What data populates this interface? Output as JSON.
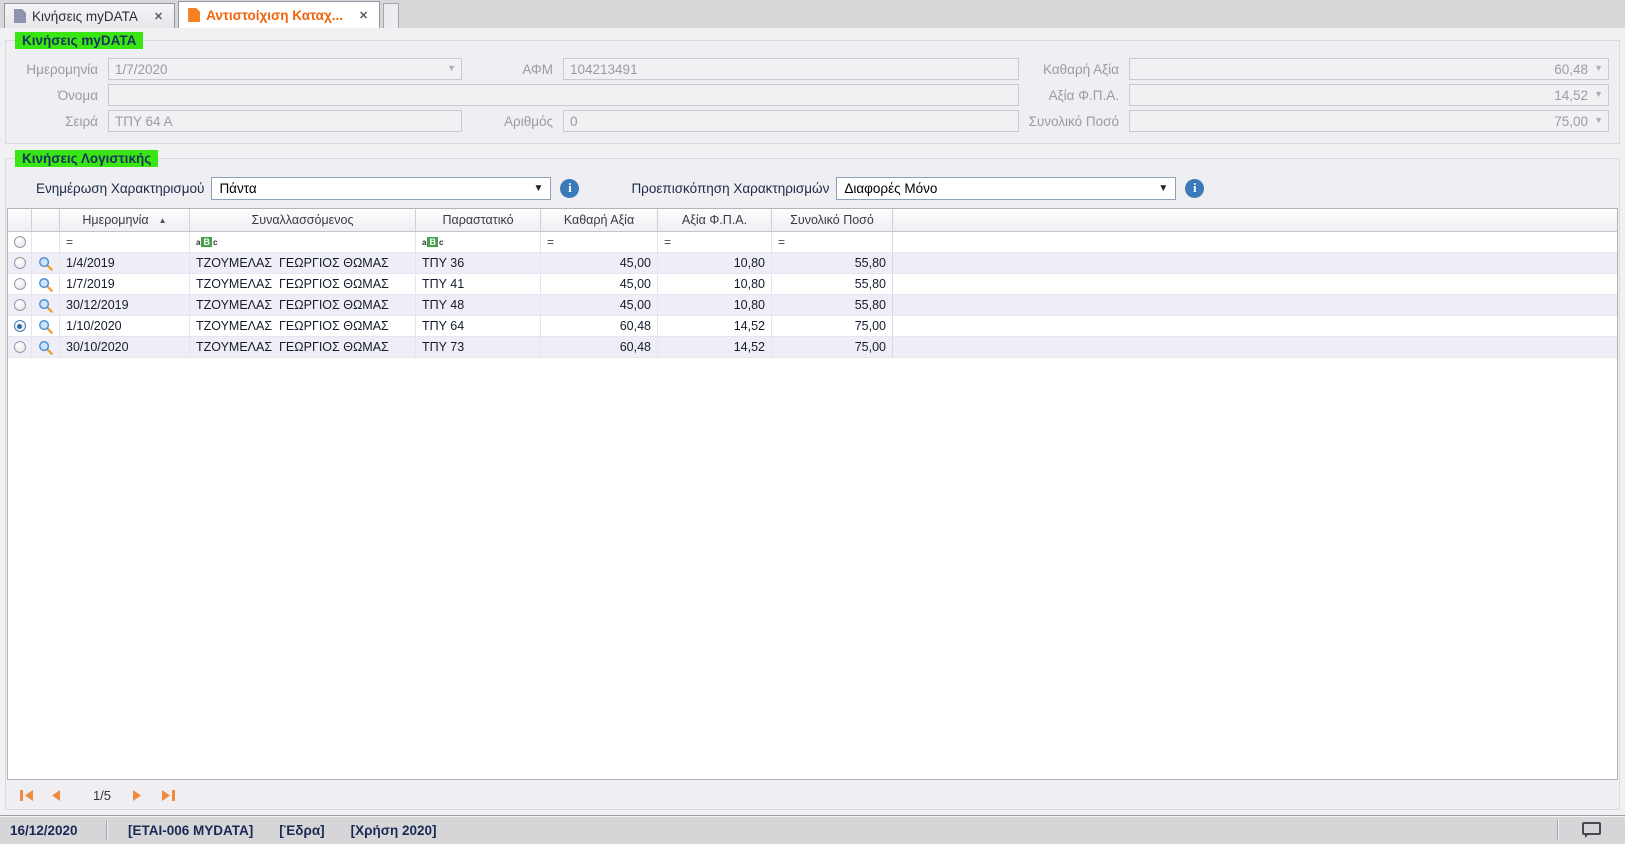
{
  "colors": {
    "highlight_green": "#39e614",
    "active_tab_text": "#f2620a",
    "inactive_tab_icon": "#8e93b0",
    "active_tab_icon": "#f58220",
    "info_icon_blue": "#3a7ab8",
    "pagination_orange": "#ee8b3e",
    "abc_filter_green": "#43a047",
    "status_text_navy": "#1b2a55"
  },
  "icons": {
    "close": "✕",
    "dropdown_arrow": "▼",
    "small_arrow": "▼",
    "sort_asc": "▲",
    "info": "i",
    "equals": "=",
    "abc_a": "a",
    "abc_b": "B",
    "abc_c": "c"
  },
  "tab_bar": {
    "tabs": [
      {
        "label": "Κινήσεις myDATA",
        "active": false
      },
      {
        "label": "Αντιστοίχιση Καταχ...",
        "active": true
      }
    ]
  },
  "mydata_panel": {
    "title": "Κινήσεις myDATA",
    "fields": {
      "date": {
        "label": "Ημερομηνία",
        "value": "1/7/2020"
      },
      "afm": {
        "label": "ΑΦΜ",
        "value": "104213491"
      },
      "net": {
        "label": "Καθαρή Αξία",
        "value": "60,48"
      },
      "name": {
        "label": "Όνομα",
        "value": ""
      },
      "vat": {
        "label": "Αξία Φ.Π.Α.",
        "value": "14,52"
      },
      "series": {
        "label": "Σειρά",
        "value": "ΤΠΥ 64 Α"
      },
      "number": {
        "label": "Αριθμός",
        "value": "0"
      },
      "total": {
        "label": "Συνολικό Ποσό",
        "value": "75,00"
      }
    }
  },
  "accounting_panel": {
    "title": "Κινήσεις Λογιστικής",
    "update_characterization": {
      "label": "Ενημέρωση Χαρακτηρισμού",
      "value": "Πάντα"
    },
    "preview_characterizations": {
      "label": "Προεπισκόπηση Χαρακτηρισμών",
      "value": "Διαφορές Μόνο"
    }
  },
  "grid": {
    "columns": [
      "Ημερομηνία",
      "Συναλλασσόμενος",
      "Παραστατικό",
      "Καθαρή Αξία",
      "Αξία Φ.Π.Α.",
      "Συνολικό Ποσό"
    ],
    "sorted_column": "Ημερομηνία",
    "sort_direction": "asc",
    "filter_ops": [
      "=",
      "aBc",
      "aBc",
      "=",
      "=",
      "="
    ],
    "rows": [
      {
        "date": "1/4/2019",
        "counterpart": "ΤΖΟΥΜΕΛΑΣ  ΓΕΩΡΓΙΟΣ ΘΩΜΑΣ",
        "document": "ΤΠΥ 36",
        "net": "45,00",
        "vat": "10,80",
        "total": "55,80",
        "selected": false
      },
      {
        "date": "1/7/2019",
        "counterpart": "ΤΖΟΥΜΕΛΑΣ  ΓΕΩΡΓΙΟΣ ΘΩΜΑΣ",
        "document": "ΤΠΥ 41",
        "net": "45,00",
        "vat": "10,80",
        "total": "55,80",
        "selected": false
      },
      {
        "date": "30/12/2019",
        "counterpart": "ΤΖΟΥΜΕΛΑΣ  ΓΕΩΡΓΙΟΣ ΘΩΜΑΣ",
        "document": "ΤΠΥ 48",
        "net": "45,00",
        "vat": "10,80",
        "total": "55,80",
        "selected": false
      },
      {
        "date": "1/10/2020",
        "counterpart": "ΤΖΟΥΜΕΛΑΣ  ΓΕΩΡΓΙΟΣ ΘΩΜΑΣ",
        "document": "ΤΠΥ 64",
        "net": "60,48",
        "vat": "14,52",
        "total": "75,00",
        "selected": true
      },
      {
        "date": "30/10/2020",
        "counterpart": "ΤΖΟΥΜΕΛΑΣ  ΓΕΩΡΓΙΟΣ ΘΩΜΑΣ",
        "document": "ΤΠΥ 73",
        "net": "60,48",
        "vat": "14,52",
        "total": "75,00",
        "selected": false
      }
    ]
  },
  "pagination": {
    "current_page_label": "1/5"
  },
  "status_bar": {
    "date": "16/12/2020",
    "company": "[ΕΤΑΙ-006 MYDATA]",
    "branch": "[Έδρα]",
    "fiscal_year": "[Χρήση 2020]"
  }
}
